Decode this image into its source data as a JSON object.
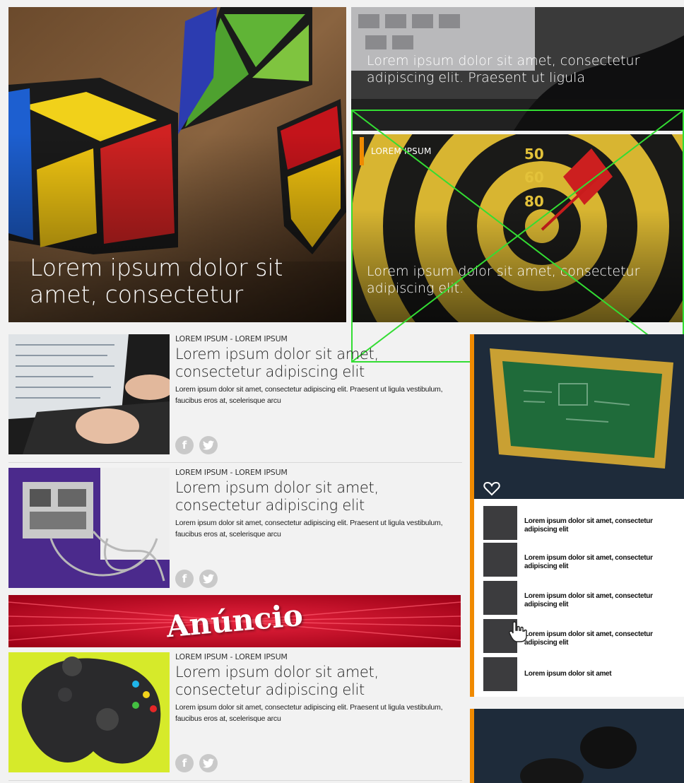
{
  "hero": {
    "main_title": "Lorem ipsum dolor sit amet, consectetur",
    "top_right_title": "Lorem ipsum dolor sit amet, consectetur adipiscing elit. Praesent ut ligula",
    "mid_right_category": "LOREM IPSUM",
    "mid_right_title": "Lorem ipsum dolor sit amet, consectetur adipiscing elit.",
    "dart_numbers": [
      "50",
      "60",
      "80"
    ]
  },
  "articles": [
    {
      "meta": "LOREM IPSUM - LOREM IPSUM",
      "title": "Lorem ipsum dolor sit amet, consectetur adipiscing elit",
      "description": "Lorem ipsum dolor sit amet, consectetur adipiscing elit. Praesent ut ligula vestibulum, faucibus eros at, scelerisque arcu",
      "image": "laptop-typing"
    },
    {
      "meta": "LOREM IPSUM - LOREM IPSUM",
      "title": "Lorem ipsum dolor sit amet, consectetur adipiscing elit",
      "description": "Lorem ipsum dolor sit amet, consectetur adipiscing elit. Praesent ut ligula vestibulum, faucibus eros at, scelerisque arcu",
      "image": "circuit-board-cables"
    },
    {
      "meta": "LOREM IPSUM - LOREM IPSUM",
      "title": "Lorem ipsum dolor sit amet, consectetur adipiscing elit",
      "description": "Lorem ipsum dolor sit amet, consectetur adipiscing elit. Praesent ut ligula vestibulum, faucibus eros at, scelerisque arcu",
      "image": "game-controller"
    }
  ],
  "social": {
    "facebook_glyph": "f",
    "twitter_icon": "twitter-icon"
  },
  "ad": {
    "label": "Anúncio"
  },
  "sidebar": {
    "items": [
      "Lorem ipsum dolor sit amet, consectetur adipiscing elit",
      "Lorem ipsum dolor sit amet, consectetur adipiscing elit",
      "Lorem ipsum dolor sit amet, consectetur adipiscing elit",
      "Lorem ipsum dolor sit amet, consectetur adipiscing elit",
      "Lorem ipsum dolor sit amet"
    ]
  },
  "colors": {
    "accent": "#f08a00",
    "overlay_green": "#33dd33",
    "ad_red": "#c8102e",
    "sidebar_dark": "#1e2b3a"
  }
}
